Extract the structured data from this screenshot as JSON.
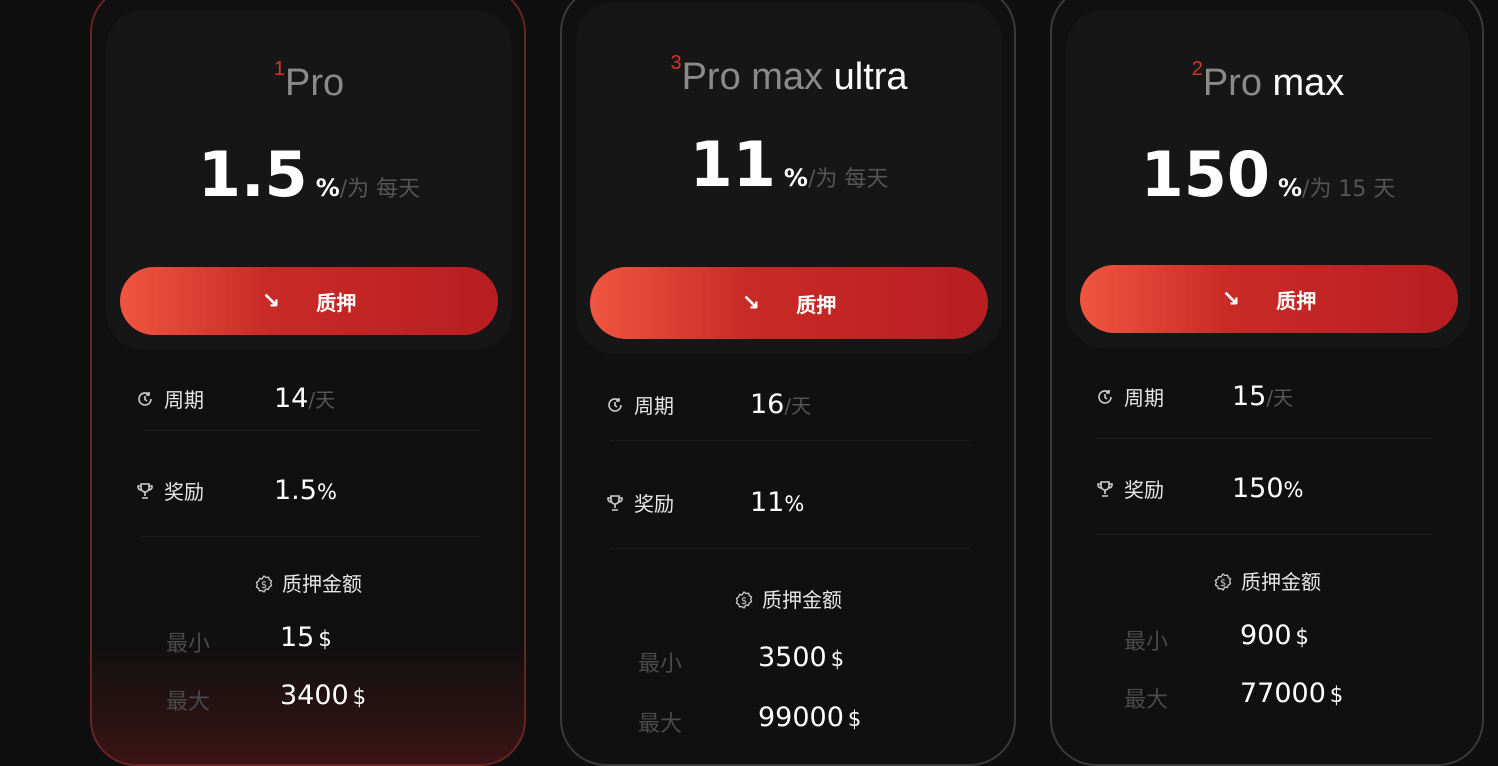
{
  "plans": [
    {
      "rank": "1",
      "name_grey": "Pro",
      "name_white": "",
      "rate": "1.5",
      "pct_sign": "%",
      "period_text": "/为 每天",
      "button_label": "质押",
      "cycle_label": "周期",
      "cycle_value": "14",
      "cycle_unit": "/天",
      "reward_label": "奖励",
      "reward_value": "1.5",
      "reward_unit": "%",
      "amount_label": "质押金额",
      "min_label": "最小",
      "min_value": "15",
      "max_label": "最大",
      "max_value": "3400",
      "currency": "$"
    },
    {
      "rank": "3",
      "name_grey": "Pro max",
      "name_white": "ultra",
      "rate": "11",
      "pct_sign": "%",
      "period_text": "/为 每天",
      "button_label": "质押",
      "cycle_label": "周期",
      "cycle_value": "16",
      "cycle_unit": "/天",
      "reward_label": "奖励",
      "reward_value": "11",
      "reward_unit": "%",
      "amount_label": "质押金额",
      "min_label": "最小",
      "min_value": "3500",
      "max_label": "最大",
      "max_value": "99000",
      "currency": "$"
    },
    {
      "rank": "2",
      "name_grey": "Pro",
      "name_white": "max",
      "rate": "150",
      "pct_sign": "%",
      "period_text": "/为 15 天",
      "button_label": "质押",
      "cycle_label": "周期",
      "cycle_value": "15",
      "cycle_unit": "/天",
      "reward_label": "奖励",
      "reward_value": "150",
      "reward_unit": "%",
      "amount_label": "质押金额",
      "min_label": "最小",
      "min_value": "900",
      "max_label": "最大",
      "max_value": "77000",
      "currency": "$"
    }
  ],
  "colors": {
    "accent_start": "#ef5640",
    "accent_end": "#b81e22",
    "rank_red": "#d8322b",
    "active_border": "#6b2424"
  },
  "icons": {
    "button": "arrow-down-right-icon",
    "cycle": "clock-icon",
    "reward": "trophy-icon",
    "amount": "dollar-coin-icon"
  }
}
